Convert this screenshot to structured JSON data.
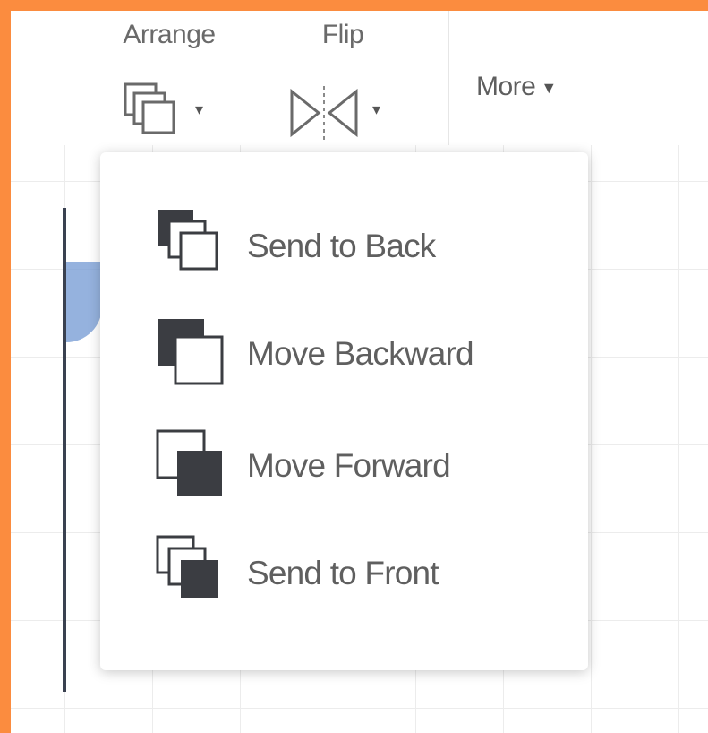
{
  "toolbar": {
    "arrange_label": "Arrange",
    "flip_label": "Flip",
    "more_label": "More",
    "more_caret": "▼",
    "arrange_caret": "▾",
    "flip_caret": "▾"
  },
  "arrange_menu": {
    "items": [
      {
        "label": "Send to Back",
        "icon": "send-to-back-icon"
      },
      {
        "label": "Move Backward",
        "icon": "move-backward-icon"
      },
      {
        "label": "Move Forward",
        "icon": "move-forward-icon"
      },
      {
        "label": "Send to Front",
        "icon": "send-to-front-icon"
      }
    ]
  },
  "colors": {
    "frame_border": "#fb8c3f",
    "icon_dark": "#3b3d42",
    "text": "#5f5f5f"
  }
}
